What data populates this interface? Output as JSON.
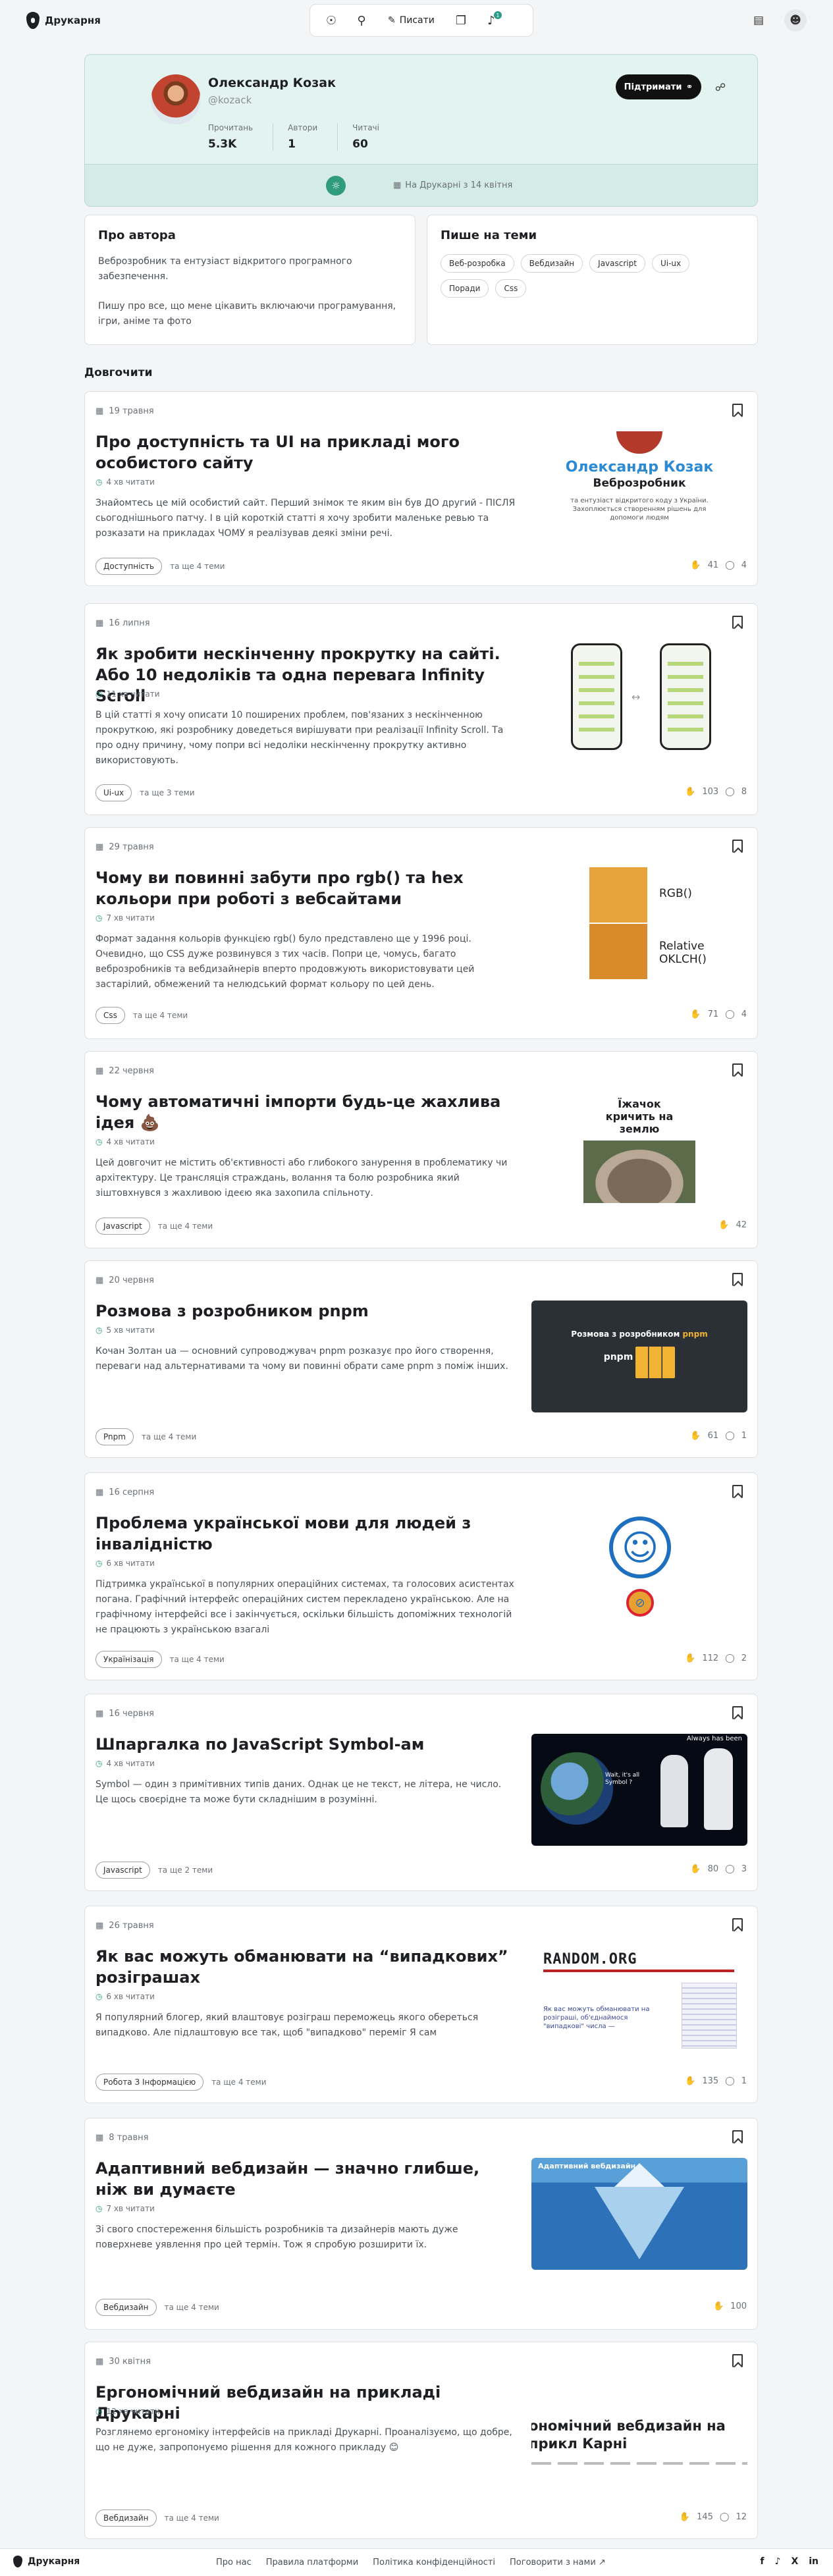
{
  "app": {
    "name": "Друкарня"
  },
  "nav": {
    "write_label": "Писати",
    "notif_count": "1"
  },
  "profile": {
    "name": "Олександр Козак",
    "handle": "@kozack",
    "stats": [
      {
        "label": "Прочитань",
        "value": "5.3K"
      },
      {
        "label": "Автори",
        "value": "1"
      },
      {
        "label": "Читачі",
        "value": "60"
      }
    ],
    "support_label": "Підтримати",
    "since": "На Друкарні з 14 квітня"
  },
  "about": {
    "title": "Про автора",
    "p1": "Веброзробник та ентузіаст відкритого програмного забезпечення.",
    "p2": "Пишу про все, що мене цікавить включаючи програмування, ігри, аніме та фото"
  },
  "topics": {
    "title": "Пише на теми",
    "items": [
      "Веб-розробка",
      "Вебдизайн",
      "Javascript",
      "Ui-ux",
      "Поради",
      "Css"
    ]
  },
  "section_title": "Довгочити",
  "articles": [
    {
      "date": "19 травня",
      "title": "Про доступність та UI на прикладі мого особистого сайту",
      "read": "4 хв читати",
      "desc": "Знайомтесь це мій особистий сайт. Перший знімок те яким він був ДО другий - ПІСЛЯ сьогоднішнього патчу. І в цій короткій статті я хочу зробити маленьке ревью та розказати на прикладах ЧОМУ я реалізував деякі зміни речі.",
      "tag": "Доступність",
      "more": "та ще 4 теми",
      "likes": "41",
      "comments": "4"
    },
    {
      "date": "16 липня",
      "title": "Як зробити нескінченну прокрутку на сайті. Або 10 недоліків та одна перевага Infinity Scroll",
      "read": "11 хв читати",
      "desc": "В цій статті я хочу описати 10 поширених проблем, пов'язаних з нескінченною прокруткою, які розробнику доведеться вирішувати при реалізації Infinity Scroll. Та про одну причину, чому попри всі недоліки нескінченну прокрутку активно використовують.",
      "tag": "Ui-ux",
      "more": "та ще 3 теми",
      "likes": "103",
      "comments": "8"
    },
    {
      "date": "29 травня",
      "title": "Чому ви повинні забути про rgb() та hex кольори при роботі з вебсайтами",
      "read": "7 хв читати",
      "desc": "Формат задання кольорів функцією rgb() було представлено ще у 1996 році. Очевидно, що CSS дуже розвинувся з тих часів. Попри це, чомусь, багато веброзробників та вебдизайнерів вперто продовжують використовувати цей застарілий, обмежений та нелюдський формат кольору по цей день.",
      "tag": "Css",
      "more": "та ще 4 теми",
      "likes": "71",
      "comments": "4"
    },
    {
      "date": "22 червня",
      "title": "Чому автоматичні імпорти будь-це жахлива ідея 💩",
      "read": "4 хв читати",
      "desc": "Цей довгочит не містить об'єктивності або глибокого занурення в проблематику чи архітектуру. Це трансляція страждань, волання та болю розробника який зіштовхнувся з жахливою ідеєю яка захопила спільноту.",
      "tag": "Javascript",
      "more": "та ще 4 теми",
      "likes": "42",
      "comments": ""
    },
    {
      "date": "20 червня",
      "title": "Розмова з розробником pnpm",
      "read": "5 хв читати",
      "desc": "Кочан Золтан ua — основний супроводжувач pnpm розказує про його створення, переваги над альтернативами та чому ви повинні обрати саме pnpm з поміж інших.",
      "tag": "Pnpm",
      "more": "та ще 4 теми",
      "likes": "61",
      "comments": "1"
    },
    {
      "date": "16 серпня",
      "title": "Проблема української мови для людей з інвалідністю",
      "read": "6 хв читати",
      "desc": "Підтримка української в популярних операційних системах, та голосових асистентах погана. Графічний інтерфейс операційних систем перекладено українською. Але на графічному інтерфейсі все і закінчується, оскільки більшість допоміжних технологій не працюють з українською взагалі",
      "tag": "Українізація",
      "more": "та ще 4 теми",
      "likes": "112",
      "comments": "2"
    },
    {
      "date": "16 червня",
      "title": "Шпаргалка по JavaScript Symbol-ам",
      "read": "4 хв читати",
      "desc": "Symbol — один з примітивних типів даних. Однак це не текст, не літера, не число. Це щось своєрідне та може бути складнішим в розумінні.",
      "tag": "Javascript",
      "more": "та ще 2 теми",
      "likes": "80",
      "comments": "3"
    },
    {
      "date": "26 травня",
      "title": "Як вас можуть обманювати на “випадкових” розіграшах",
      "read": "6 хв читати",
      "desc": "Я популярний блогер, який влаштовує розіграш переможець якого обереться випадково. Але підлаштовую все так, щоб \"випадково\" переміг Я сам",
      "tag": "Робота З Інформацією",
      "more": "та ще 4 теми",
      "likes": "135",
      "comments": "1"
    },
    {
      "date": "8 травня",
      "title": "Адаптивний вебдизайн — значно глибше, ніж ви думаєте",
      "read": "7 хв читати",
      "desc": "Зі свого спостереження більшість розробників та дизайнерів мають дуже поверхневе уявлення про цей термін. Тож я спробую розширити їх.",
      "tag": "Вебдизайн",
      "more": "та ще 4 теми",
      "likes": "100",
      "comments": ""
    },
    {
      "date": "30 квітня",
      "title": "Ергономічний вебдизайн на прикладі Друкарні",
      "read": "12 хв читати",
      "desc": "Розглянемо ергономіку інтерфейсів на прикладі Друкарні. Проаналізуємо, що добре, що не дуже, запропонуємо рішення для кожного прикладу 😊",
      "tag": "Вебдизайн",
      "more": "та ще 4 теми",
      "likes": "145",
      "comments": "12"
    }
  ],
  "thumbs": {
    "t1_name": "Олександр Козак",
    "t1_role": "Веброзробник",
    "t1_sub": "та ентузіаст відкритого коду з України. Захоплюється створенням рішень для допомоги людям",
    "t3_a": "RGB()",
    "t3_b": "Relative OKLCH()",
    "t4_caption": "Їжачок кричить на землю",
    "t5_caption": "Розмова з розробником",
    "t5_brand": "pnpm",
    "t7_caption": "Always has been",
    "t7_bubble": "Wait, it's all Symbol ?",
    "t8_brand": "RANDOM.ORG",
    "t8_text": "Як вас можуть обманювати на розіграші, об'єднаймося \"випадкові\" числа —",
    "t9_caption": "Адаптивний вебдизайн",
    "t10_caption": "ономічний вебдизайн на прикл Карні"
  },
  "footer": {
    "links": [
      "Про нас",
      "Правила платформи",
      "Політика конфіденційності",
      "Поговорити з нами ↗"
    ],
    "social": [
      "f",
      "♪",
      "X",
      "in"
    ]
  }
}
